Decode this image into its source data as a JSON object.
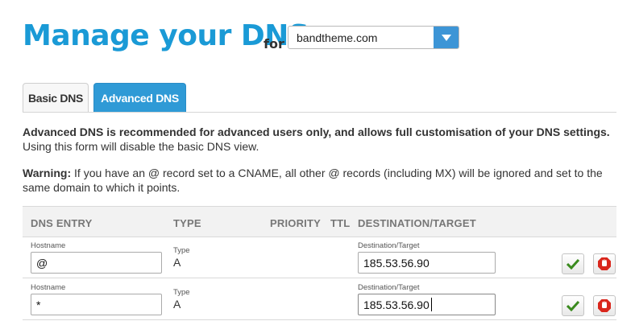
{
  "header": {
    "title": "Manage your DNS",
    "for_label": "for",
    "domain_selected": "bandtheme.com"
  },
  "tabs": [
    {
      "label": "Basic DNS",
      "active": false
    },
    {
      "label": "Advanced DNS",
      "active": true
    }
  ],
  "info": {
    "p1_bold": "Advanced DNS is recommended for advanced users only, and allows full customisation of your DNS settings.",
    "p1_rest": "Using this form will disable the basic DNS view.",
    "warning_label": "Warning:",
    "warning_text": "If you have an @ record set to a CNAME, all other @ records (including MX) will be ignored and set to the same domain to which it points."
  },
  "table": {
    "columns": [
      "DNS ENTRY",
      "TYPE",
      "PRIORITY",
      "TTL",
      "DESTINATION/TARGET"
    ],
    "field_labels": {
      "hostname": "Hostname",
      "type": "Type",
      "destination": "Destination/Target"
    },
    "rows": [
      {
        "hostname": "@",
        "type": "A",
        "destination": "185.53.56.90"
      },
      {
        "hostname": "*",
        "type": "A",
        "destination": "185.53.56.90"
      }
    ]
  },
  "colors": {
    "brand": "#1a9ad6",
    "tab_active": "#2f9ad6",
    "check": "#3a8a1e",
    "delete": "#d9261c"
  },
  "icons": [
    "chevron-down-icon",
    "checkmark-icon",
    "stop-hand-icon"
  ]
}
